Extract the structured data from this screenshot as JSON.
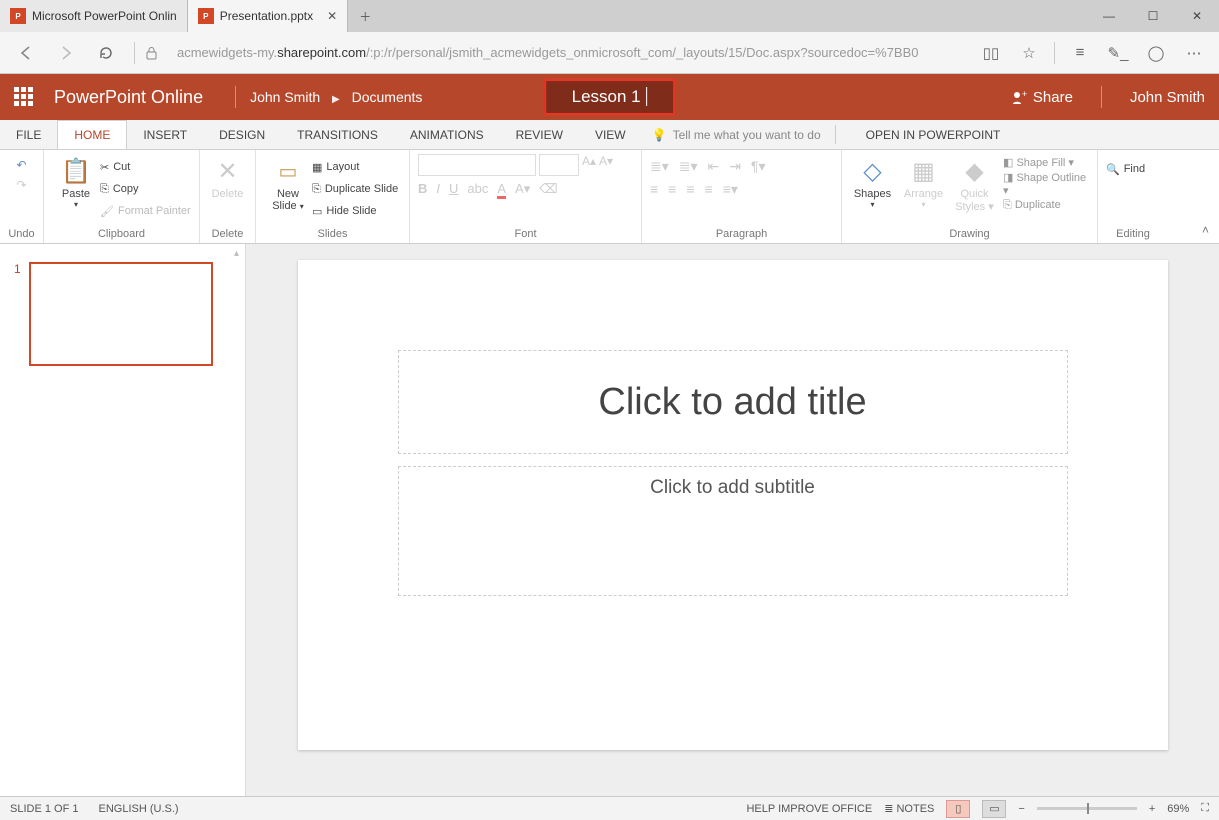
{
  "browser": {
    "tabs": [
      {
        "label": "Microsoft PowerPoint Onlin"
      },
      {
        "label": "Presentation.pptx"
      }
    ],
    "url_pre": "acmewidgets-my.",
    "url_dark": "sharepoint.com",
    "url_post": "/:p:/r/personal/jsmith_acmewidgets_onmicrosoft_com/_layouts/15/Doc.aspx?sourcedoc=%7BB0"
  },
  "header": {
    "app_name": "PowerPoint Online",
    "user": "John Smith",
    "breadcrumb2": "Documents",
    "title": "Lesson 1",
    "share": "Share",
    "username": "John Smith"
  },
  "tabs": {
    "file": "FILE",
    "home": "HOME",
    "insert": "INSERT",
    "design": "DESIGN",
    "transitions": "TRANSITIONS",
    "animations": "ANIMATIONS",
    "review": "REVIEW",
    "view": "VIEW",
    "tell_me": "Tell me what you want to do",
    "open_in": "OPEN IN POWERPOINT"
  },
  "ribbon": {
    "undo": "Undo",
    "paste": "Paste",
    "cut": "Cut",
    "copy": "Copy",
    "format_painter": "Format Painter",
    "clipboard": "Clipboard",
    "delete": "Delete",
    "delete_label": "Delete",
    "new_slide": "New",
    "new_slide2": "Slide",
    "layout": "Layout",
    "duplicate_slide": "Duplicate Slide",
    "hide_slide": "Hide Slide",
    "slides": "Slides",
    "font": "Font",
    "paragraph": "Paragraph",
    "shapes": "Shapes",
    "arrange": "Arrange",
    "quick_styles": "Quick",
    "quick_styles2": "Styles",
    "shape_fill": "Shape Fill",
    "shape_outline": "Shape Outline",
    "duplicate": "Duplicate",
    "drawing": "Drawing",
    "find": "Find",
    "editing": "Editing"
  },
  "thumb": {
    "num": "1"
  },
  "slide": {
    "title_placeholder": "Click to add title",
    "subtitle_placeholder": "Click to add subtitle"
  },
  "status": {
    "slide": "SLIDE 1 OF 1",
    "lang": "ENGLISH (U.S.)",
    "help": "HELP IMPROVE OFFICE",
    "notes": "NOTES",
    "zoom": "69%"
  }
}
